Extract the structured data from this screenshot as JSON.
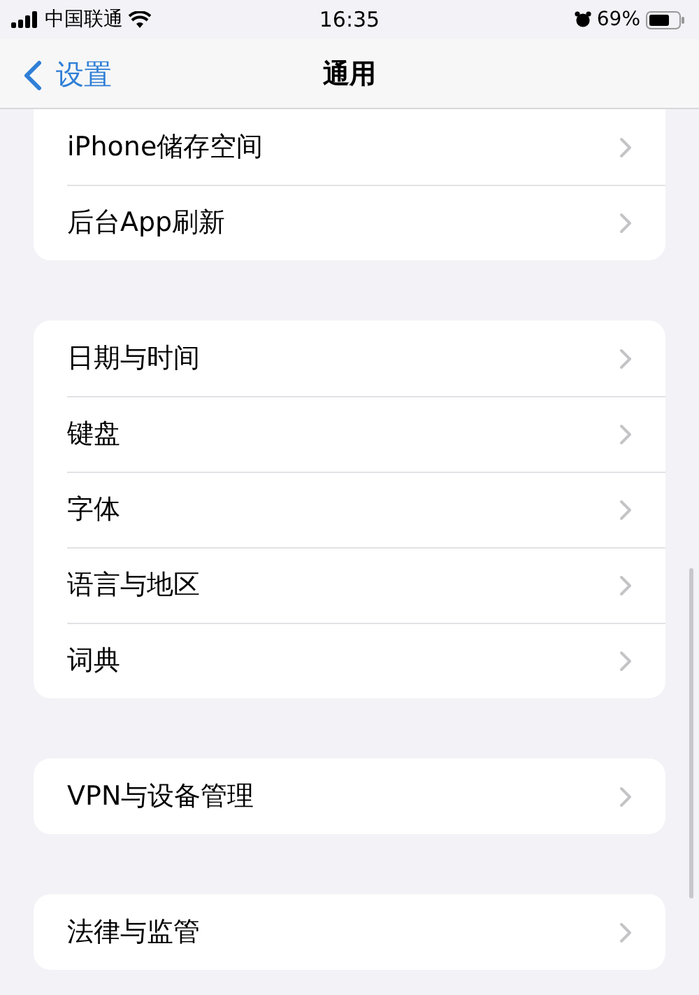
{
  "status_bar": {
    "carrier": "中国联通",
    "time": "16:35",
    "battery": "69%"
  },
  "nav": {
    "back": "设置",
    "title": "通用"
  },
  "groups": [
    {
      "rows": [
        {
          "label": "iPhone储存空间"
        },
        {
          "label": "后台App刷新"
        }
      ]
    },
    {
      "rows": [
        {
          "label": "日期与时间"
        },
        {
          "label": "键盘"
        },
        {
          "label": "字体"
        },
        {
          "label": "语言与地区"
        },
        {
          "label": "词典"
        }
      ]
    },
    {
      "rows": [
        {
          "label": "VPN与设备管理"
        }
      ]
    },
    {
      "rows": [
        {
          "label": "法律与监管"
        }
      ]
    }
  ]
}
